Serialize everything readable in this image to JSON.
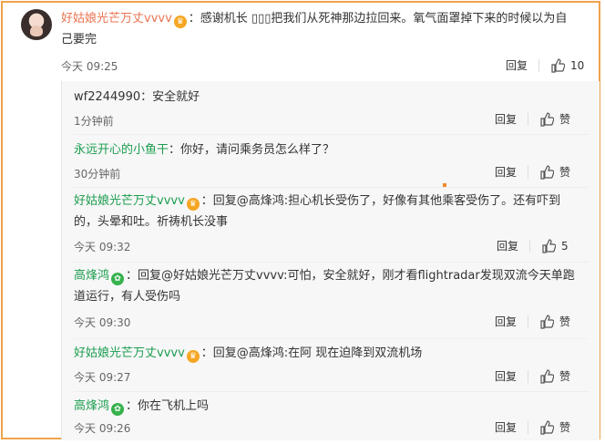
{
  "main": {
    "username": "好姑娘光芒万丈vvvv",
    "badge": "♛",
    "text_line1": "：感谢机长 ▯▯▯把我们从死神那边拉回来。氧气面罩掉下来的时候以为自",
    "text_line2": "己要完",
    "time": "今天 09:25",
    "reply_label": "回复",
    "like_count": "10"
  },
  "replies": [
    {
      "username": "wf2244990",
      "text_line1": "：安全就好",
      "text_line2": "",
      "time": "1分钟前",
      "reply_label": "回复",
      "like_label": "赞"
    },
    {
      "username": "永远开心的小鱼干",
      "text_line1": "：你好，请问乘务员怎么样了？",
      "text_line2": "",
      "time": "30分钟前",
      "reply_label": "回复",
      "like_label": "赞"
    },
    {
      "username": "好姑娘光芒万丈vvvv",
      "badge": "♛",
      "text_line1": "：回复@高烽鸿:担心机长受伤了，好像有其他乘客受伤了。还有吓到",
      "text_line2": "的，头晕和吐。祈祷机长没事",
      "time": "今天 09:32",
      "reply_label": "回复",
      "like_label": "5"
    },
    {
      "username": "高烽鸿",
      "badge": "✿",
      "text_line1": "：回复@好姑娘光芒万丈vvvv:可怕，安全就好，刚才看flightradar发现双流今天单跑",
      "text_line2": "道运行，有人受伤吗",
      "time": "今天 09:30",
      "reply_label": "回复",
      "like_label": "赞"
    },
    {
      "username": "好姑娘光芒万丈vvvv",
      "badge": "♛",
      "text_line1": "：回复@高烽鸿:在阿 现在迫降到双流机场",
      "text_line2": "",
      "time": "今天 09:27",
      "reply_label": "回复",
      "like_label": "赞"
    },
    {
      "username": "高烽鸿",
      "badge": "✿",
      "text_line1": "：你在飞机上吗",
      "text_line2": "",
      "time": "今天 09:26",
      "reply_label": "回复",
      "like_label": "赞"
    }
  ],
  "colors": {
    "border": "#f0a24d",
    "username": "#eb7350",
    "alt_username": "#1b9d4f"
  }
}
